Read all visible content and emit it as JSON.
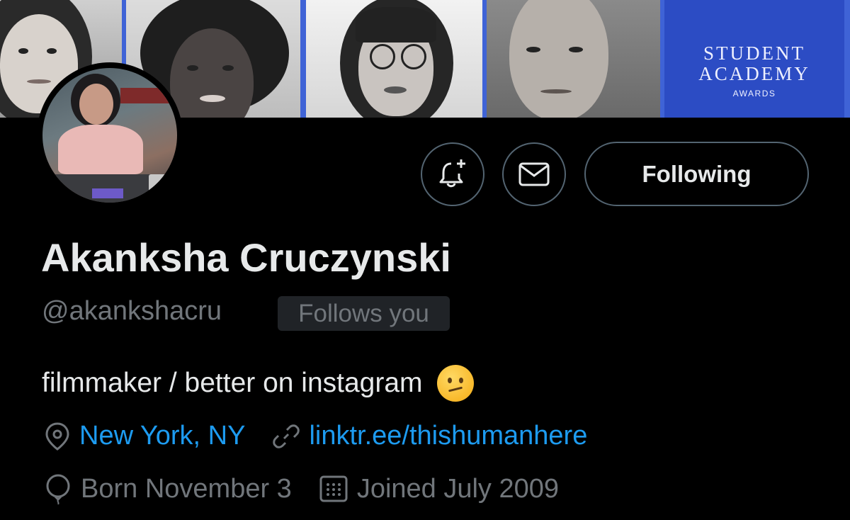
{
  "banner": {
    "award_line1": "STUDENT",
    "award_line2": "ACADEMY",
    "award_line3": "AWARDS",
    "accent_color": "#3f63d6"
  },
  "profile": {
    "display_name": "Akanksha Cruczynski",
    "handle": "@akankshacru",
    "follows_badge": "Follows you",
    "bio": "filmmaker / better on instagram",
    "bio_emoji": "confused-face-emoji",
    "location": "New York, NY",
    "website": "linktr.ee/thishumanhere",
    "birthday": "Born November 3",
    "joined": "Joined July 2009"
  },
  "actions": {
    "notify_icon": "bell-plus-icon",
    "message_icon": "envelope-icon",
    "follow_state_label": "Following"
  },
  "colors": {
    "background": "#000000",
    "primary_text": "#e7e9ea",
    "secondary_text": "#71767b",
    "link": "#1d9bf0",
    "button_border": "#536471"
  }
}
